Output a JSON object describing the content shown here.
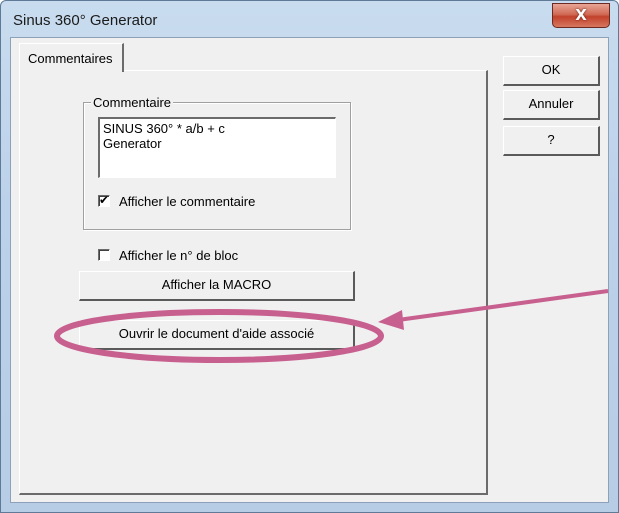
{
  "window": {
    "title": "Sinus 360° Generator",
    "close_glyph": "X"
  },
  "tabs": [
    {
      "label": "Commentaires"
    }
  ],
  "group": {
    "legend": "Commentaire",
    "comment_lines": [
      "SINUS 360°  * a/b + c",
      "Generator"
    ],
    "show_comment": {
      "label": "Afficher le commentaire",
      "checked": true
    }
  },
  "show_block_number": {
    "label": "Afficher le n° de bloc",
    "checked": false
  },
  "buttons": {
    "show_macro": "Afficher la MACRO",
    "open_help": "Ouvrir le document d'aide associé",
    "ok": "OK",
    "cancel": "Annuler",
    "help": "?"
  },
  "annotation": {
    "color": "#c8608f"
  }
}
